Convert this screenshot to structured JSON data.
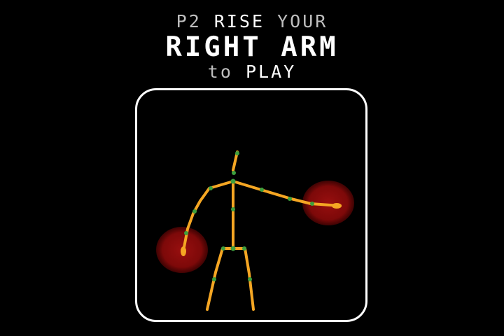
{
  "prompt": {
    "player": "P2",
    "verb": "RISE",
    "your": "YOUR",
    "target": "RIGHT ARM",
    "to": "to",
    "action": "PLAY"
  },
  "colors": {
    "background": "#000000",
    "text_bright": "#ffffff",
    "text_dim": "#bfbfbf",
    "frame_border": "#ffffff",
    "bone": "#f5a623",
    "joint": "#3e9f3e",
    "hand_target": "#8b0a0a"
  },
  "icons": {
    "skeleton": "stick-figure-icon",
    "hand_targets": "red-circle-target-icon"
  }
}
